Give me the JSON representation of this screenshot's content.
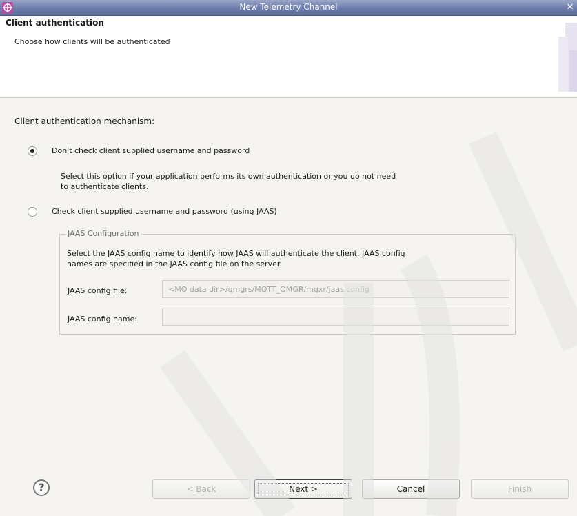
{
  "window": {
    "title": "New Telemetry Channel"
  },
  "header": {
    "title": "Client authentication",
    "description": "Choose how clients will be authenticated"
  },
  "mechanism": {
    "label": "Client authentication mechanism:",
    "options": [
      {
        "label": "Don't check client supplied username and password",
        "checked": true,
        "description_line1": "Select this option if your application performs its own authentication or you do not need",
        "description_line2": "to authenticate clients."
      },
      {
        "label": "Check client supplied username and password (using JAAS)",
        "checked": false
      }
    ]
  },
  "jaas": {
    "group_title": "JAAS Configuration",
    "description_line1": "Select the JAAS config name to identify how JAAS will authenticate the client. JAAS config",
    "description_line2": "names are specified in the JAAS config file on the server.",
    "config_file_label": "JAAS config file:",
    "config_file_value": "<MQ data dir>/qmgrs/MQTT_QMGR/mqxr/jaas.config",
    "config_name_label": "JAAS config name:",
    "config_name_value": ""
  },
  "footer": {
    "back_pre": "< ",
    "back_mn": "B",
    "back_post": "ack",
    "next_mn": "N",
    "next_post": "ext >",
    "cancel": "Cancel",
    "finish_mn": "F",
    "finish_post": "inish"
  }
}
